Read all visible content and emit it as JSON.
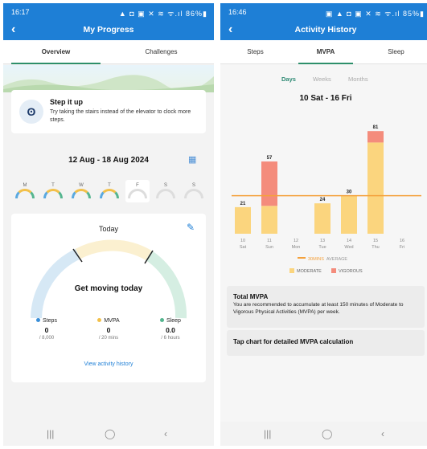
{
  "left": {
    "status_time": "16:17",
    "status_icons": "▲   ◘ ▣ ✕ ≋ ᯤ.ıl 86%▮",
    "title": "My Progress",
    "tabs": [
      {
        "label": "Overview",
        "active": true
      },
      {
        "label": "Challenges",
        "active": false
      }
    ],
    "tip": {
      "title": "Step it up",
      "text": "Try taking the stairs instead of the elevator to clock more steps."
    },
    "date_range": "12 Aug - 18 Aug 2024",
    "days": [
      {
        "letter": "M",
        "selected": false
      },
      {
        "letter": "T",
        "selected": false
      },
      {
        "letter": "W",
        "selected": false
      },
      {
        "letter": "T",
        "selected": false
      },
      {
        "letter": "F",
        "selected": true
      },
      {
        "letter": "S",
        "selected": false
      },
      {
        "letter": "S",
        "selected": false
      }
    ],
    "today": {
      "label": "Today",
      "message": "Get moving today",
      "stats": [
        {
          "label": "Steps",
          "value": "0",
          "goal": "/ 8,000",
          "color": "#3a8fd8"
        },
        {
          "label": "MVPA",
          "value": "0",
          "goal": "/ 20 mins",
          "color": "#f2c04a"
        },
        {
          "label": "Sleep",
          "value": "0.0",
          "goal": "/ 6 hours",
          "color": "#55b58f"
        }
      ],
      "link": "View activity history"
    }
  },
  "right": {
    "status_time": "16:46",
    "status_icons": "▣ ▲   ◘ ▣ ✕ ≋ ᯤ.ıl 85%▮",
    "title": "Activity History",
    "tabs": [
      {
        "label": "Steps",
        "active": false
      },
      {
        "label": "MVPA",
        "active": true
      },
      {
        "label": "Sleep",
        "active": false
      }
    ],
    "periods": [
      {
        "label": "Days",
        "active": true
      },
      {
        "label": "Weeks",
        "active": false
      },
      {
        "label": "Months",
        "active": false
      }
    ],
    "week_label": "10 Sat  - 16 Fri",
    "legend": {
      "avg_value": "30MINS",
      "avg_label": "AVERAGE",
      "moderate": "MODERATE",
      "vigorous": "VIGOROUS"
    },
    "total_title": "Total MVPA",
    "total_text": "You are recommended to accumulate at least 150 minutes of Moderate to Vigorous Physical Activities (MVPA) per week.",
    "tap_text": "Tap chart for detailed MVPA calculation"
  },
  "chart_data": {
    "type": "bar",
    "categories": [
      {
        "date": "10",
        "day": "Sat"
      },
      {
        "date": "11",
        "day": "Sun"
      },
      {
        "date": "12",
        "day": "Mon"
      },
      {
        "date": "13",
        "day": "Tue"
      },
      {
        "date": "14",
        "day": "Wed"
      },
      {
        "date": "15",
        "day": "Thu"
      },
      {
        "date": "16",
        "day": "Fri"
      }
    ],
    "totals": [
      21,
      57,
      null,
      24,
      30,
      81,
      null
    ],
    "series": [
      {
        "name": "MODERATE",
        "color": "#fbd57e",
        "values": [
          21,
          22,
          0,
          24,
          30,
          72,
          0
        ]
      },
      {
        "name": "VIGOROUS",
        "color": "#f48c7c",
        "values": [
          0,
          35,
          0,
          0,
          0,
          9,
          0
        ]
      }
    ],
    "average": 30,
    "average_color": "#f4a13c",
    "ylim": [
      0,
      90
    ],
    "grid": false
  }
}
